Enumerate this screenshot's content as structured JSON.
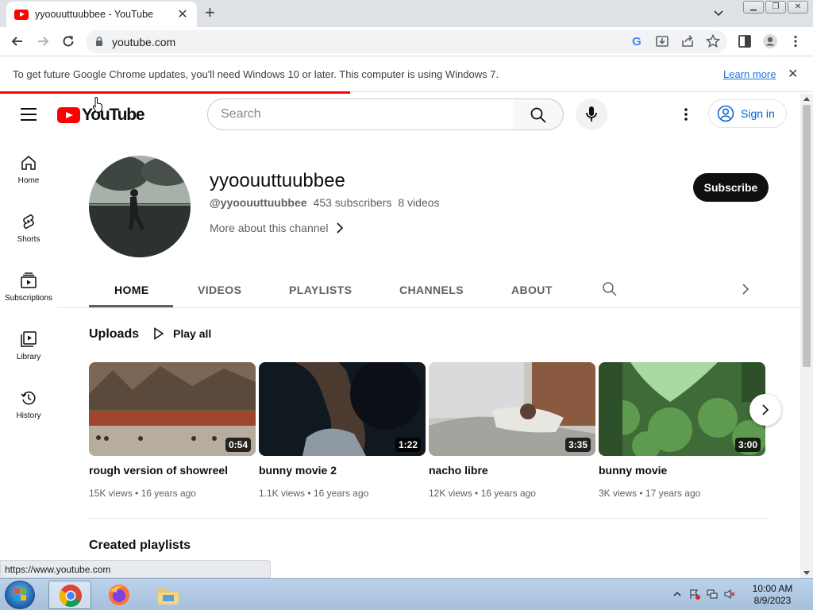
{
  "browser": {
    "tab_title": "yyoouuttuubbee - YouTube",
    "url": "youtube.com",
    "infobar_message": "To get future Google Chrome updates, you'll need Windows 10 or later. This computer is using Windows 7.",
    "infobar_link": "Learn more",
    "status_url": "https://www.youtube.com"
  },
  "masthead": {
    "logo_text": "YouTube",
    "search_placeholder": "Search",
    "sign_in": "Sign in"
  },
  "guide": {
    "items": [
      {
        "label": "Home",
        "icon": "home-icon"
      },
      {
        "label": "Shorts",
        "icon": "shorts-icon"
      },
      {
        "label": "Subscriptions",
        "icon": "subscriptions-icon"
      },
      {
        "label": "Library",
        "icon": "library-icon"
      },
      {
        "label": "History",
        "icon": "history-icon"
      }
    ]
  },
  "channel": {
    "name": "yyoouuttuubbee",
    "handle": "@yyoouuttuubbee",
    "subscribers": "453 subscribers",
    "videos": "8 videos",
    "more_about": "More about this channel",
    "subscribe": "Subscribe"
  },
  "tabs": [
    "HOME",
    "VIDEOS",
    "PLAYLISTS",
    "CHANNELS",
    "ABOUT"
  ],
  "uploads": {
    "title": "Uploads",
    "play_all": "Play all",
    "videos": [
      {
        "title": "rough version of showreel",
        "duration": "0:54",
        "views": "15K views",
        "age": "16 years ago"
      },
      {
        "title": "bunny movie 2",
        "duration": "1:22",
        "views": "1.1K views",
        "age": "16 years ago"
      },
      {
        "title": "nacho libre",
        "duration": "3:35",
        "views": "12K views",
        "age": "16 years ago"
      },
      {
        "title": "bunny movie",
        "duration": "3:00",
        "views": "3K views",
        "age": "17 years ago"
      }
    ]
  },
  "playlists": {
    "title": "Created playlists"
  },
  "taskbar": {
    "time": "10:00 AM",
    "date": "8/9/2023"
  },
  "colors": {
    "accent_red": "#ff0000",
    "link_blue": "#065fd4"
  }
}
